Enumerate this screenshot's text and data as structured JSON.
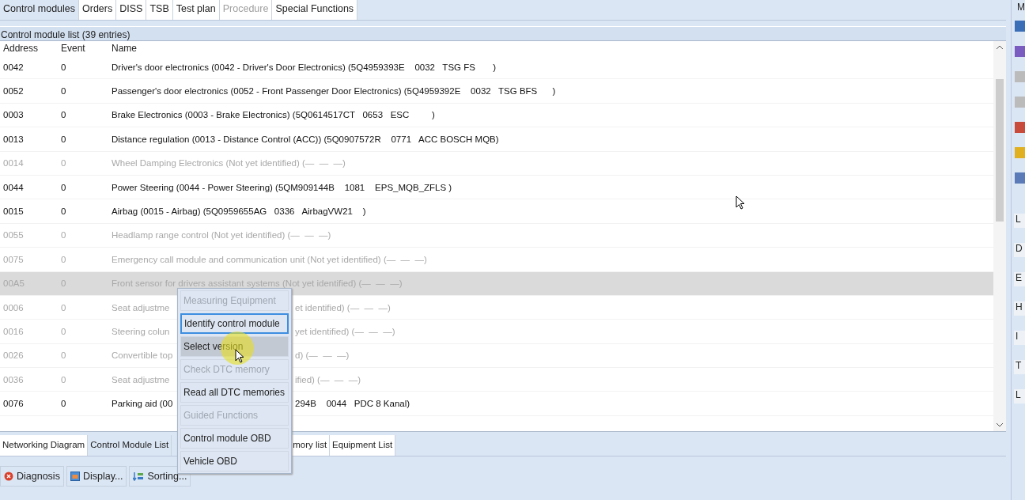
{
  "tabs": [
    {
      "label": "Control modules",
      "selected": true,
      "disabled": false
    },
    {
      "label": "Orders",
      "selected": false,
      "disabled": false
    },
    {
      "label": "DISS",
      "selected": false,
      "disabled": false
    },
    {
      "label": "TSB",
      "selected": false,
      "disabled": false
    },
    {
      "label": "Test plan",
      "selected": false,
      "disabled": false
    },
    {
      "label": "Procedure",
      "selected": false,
      "disabled": true
    },
    {
      "label": "Special Functions",
      "selected": false,
      "disabled": false
    }
  ],
  "list_title": "Control module list (39 entries)",
  "table": {
    "columns": [
      "Address",
      "Event",
      "Name"
    ],
    "rows": [
      {
        "address": "0042",
        "event": "0",
        "name": "Driver's door electronics (0042 - Driver's Door Electronics) (5Q4959393E    0032   TSG FS       )",
        "identified": true,
        "selected": false
      },
      {
        "address": "0052",
        "event": "0",
        "name": "Passenger's door electronics (0052 - Front Passenger Door Electronics) (5Q4959392E    0032   TSG BFS      )",
        "identified": true,
        "selected": false
      },
      {
        "address": "0003",
        "event": "0",
        "name": "Brake Electronics (0003 - Brake Electronics) (5Q0614517CT   0653   ESC         )",
        "identified": true,
        "selected": false
      },
      {
        "address": "0013",
        "event": "0",
        "name": "Distance regulation (0013 - Distance Control (ACC)) (5Q0907572R    0771   ACC BOSCH MQB)",
        "identified": true,
        "selected": false
      },
      {
        "address": "0014",
        "event": "0",
        "name": "Wheel Damping Electronics (Not yet identified) (—  —  —)",
        "identified": false,
        "selected": false
      },
      {
        "address": "0044",
        "event": "0",
        "name": "Power Steering (0044 - Power Steering) (5QM909144B    1081    EPS_MQB_ZFLS )",
        "identified": true,
        "selected": false
      },
      {
        "address": "0015",
        "event": "0",
        "name": "Airbag (0015 - Airbag) (5Q0959655AG   0336   AirbagVW21    )",
        "identified": true,
        "selected": false
      },
      {
        "address": "0055",
        "event": "0",
        "name": "Headlamp range control (Not yet identified) (—  —  —)",
        "identified": false,
        "selected": false
      },
      {
        "address": "0075",
        "event": "0",
        "name": "Emergency call module and communication unit (Not yet identified) (—  —  —)",
        "identified": false,
        "selected": false
      },
      {
        "address": "00A5",
        "event": "0",
        "name": "Front sensor for drivers assistant systems (Not yet identified) (—  —  —)",
        "identified": false,
        "selected": true
      },
      {
        "address": "0006",
        "event": "0",
        "name": "Seat adjustme",
        "name_after": "et identified) (—  —  —)",
        "identified": false,
        "selected": false
      },
      {
        "address": "0016",
        "event": "0",
        "name": "Steering colun",
        "name_after": "yet identified) (—  —  —)",
        "identified": false,
        "selected": false
      },
      {
        "address": "0026",
        "event": "0",
        "name": "Convertible top",
        "name_after": "d) (—  —  —)",
        "identified": false,
        "selected": false
      },
      {
        "address": "0036",
        "event": "0",
        "name": "Seat adjustme",
        "name_after": "ified) (—  —  —)",
        "identified": false,
        "selected": false
      },
      {
        "address": "0076",
        "event": "0",
        "name": "Parking aid (00",
        "name_after": "294B    0044   PDC 8 Kanal)",
        "identified": true,
        "selected": false
      }
    ]
  },
  "context_menu": [
    {
      "label": "Measuring Equipment",
      "disabled": true,
      "focused": false,
      "hovered": false
    },
    {
      "label": "Identify control module",
      "disabled": false,
      "focused": true,
      "hovered": false
    },
    {
      "label": "Select version",
      "disabled": false,
      "focused": false,
      "hovered": true
    },
    {
      "label": "Check DTC memory",
      "disabled": true,
      "focused": false,
      "hovered": false
    },
    {
      "label": "Read all DTC memories",
      "disabled": false,
      "focused": false,
      "hovered": false
    },
    {
      "label": "Guided Functions",
      "disabled": true,
      "focused": false,
      "hovered": false
    },
    {
      "label": "Control module OBD",
      "disabled": false,
      "focused": false,
      "hovered": false
    },
    {
      "label": "Vehicle OBD",
      "disabled": false,
      "focused": false,
      "hovered": false
    }
  ],
  "bottom_tabs": [
    {
      "label": "Networking Diagram",
      "selected": false
    },
    {
      "label": "Control Module List",
      "selected": true
    },
    {
      "label": "mory list",
      "selected": false
    },
    {
      "label": "Equipment List",
      "selected": false
    }
  ],
  "buttons": [
    {
      "label": "Diagnosis",
      "kind": "stop"
    },
    {
      "label": "Display...",
      "kind": "display"
    },
    {
      "label": "Sorting...",
      "kind": "sort"
    }
  ],
  "side_panel": {
    "header": "M",
    "labels": [
      "L",
      "D",
      "E",
      "H",
      "I",
      "T",
      "L"
    ]
  }
}
